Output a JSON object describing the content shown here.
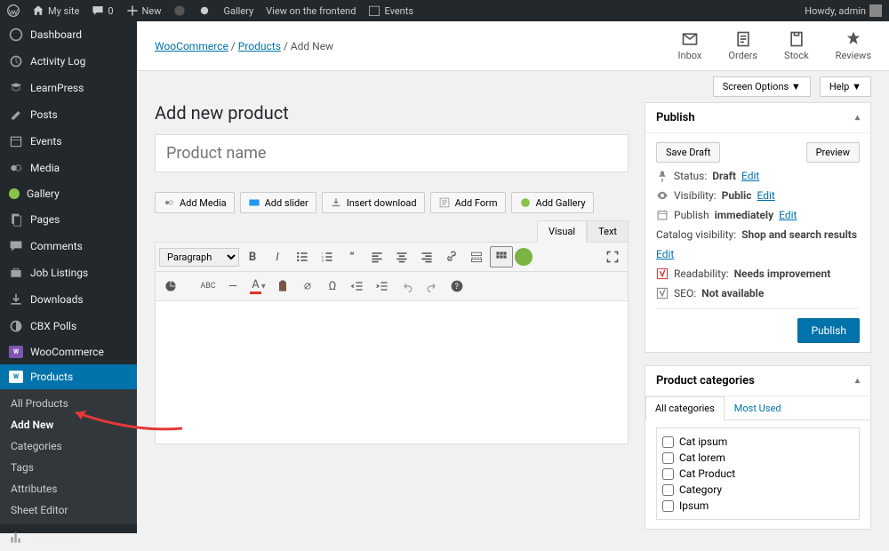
{
  "adminbar": {
    "site_name": "My site",
    "comments": "0",
    "new": "New",
    "gallery": "Gallery",
    "frontend": "View on the frontend",
    "events": "Events",
    "howdy": "Howdy, admin"
  },
  "sidebar": {
    "items": [
      {
        "label": "Dashboard"
      },
      {
        "label": "Activity Log"
      },
      {
        "label": "LearnPress"
      },
      {
        "label": "Posts"
      },
      {
        "label": "Events"
      },
      {
        "label": "Media"
      },
      {
        "label": "Gallery"
      },
      {
        "label": "Pages"
      },
      {
        "label": "Comments"
      },
      {
        "label": "Job Listings"
      },
      {
        "label": "Downloads"
      },
      {
        "label": "CBX Polls"
      },
      {
        "label": "WooCommerce"
      },
      {
        "label": "Products"
      },
      {
        "label": "Analytics"
      }
    ],
    "submenu": [
      {
        "label": "All Products"
      },
      {
        "label": "Add New"
      },
      {
        "label": "Categories"
      },
      {
        "label": "Tags"
      },
      {
        "label": "Attributes"
      },
      {
        "label": "Sheet Editor"
      }
    ]
  },
  "breadcrumb": {
    "woo": "WooCommerce",
    "products": "Products",
    "current": "Add New"
  },
  "topicons": {
    "inbox": "Inbox",
    "orders": "Orders",
    "stock": "Stock",
    "reviews": "Reviews"
  },
  "screen_opts": {
    "screen": "Screen Options",
    "help": "Help"
  },
  "page": {
    "title": "Add new product",
    "placeholder": "Product name"
  },
  "media_buttons": {
    "add_media": "Add Media",
    "add_slider": "Add slider",
    "insert_download": "Insert download",
    "add_form": "Add Form",
    "add_gallery": "Add Gallery"
  },
  "editor": {
    "visual": "Visual",
    "text": "Text",
    "format": "Paragraph"
  },
  "publish": {
    "title": "Publish",
    "save_draft": "Save Draft",
    "preview": "Preview",
    "status_label": "Status:",
    "status_value": "Draft",
    "status_edit": "Edit",
    "visibility_label": "Visibility:",
    "visibility_value": "Public",
    "visibility_edit": "Edit",
    "schedule_label": "Publish",
    "schedule_value": "immediately",
    "schedule_edit": "Edit",
    "catalog_label": "Catalog visibility:",
    "catalog_value": "Shop and search results",
    "catalog_edit": "Edit",
    "readability_label": "Readability:",
    "readability_value": "Needs improvement",
    "seo_label": "SEO:",
    "seo_value": "Not available",
    "publish_btn": "Publish"
  },
  "categories": {
    "title": "Product categories",
    "tab_all": "All categories",
    "tab_most": "Most Used",
    "items": [
      "Cat ipsum",
      "Cat lorem",
      "Cat Product",
      "Category",
      "Ipsum"
    ]
  }
}
